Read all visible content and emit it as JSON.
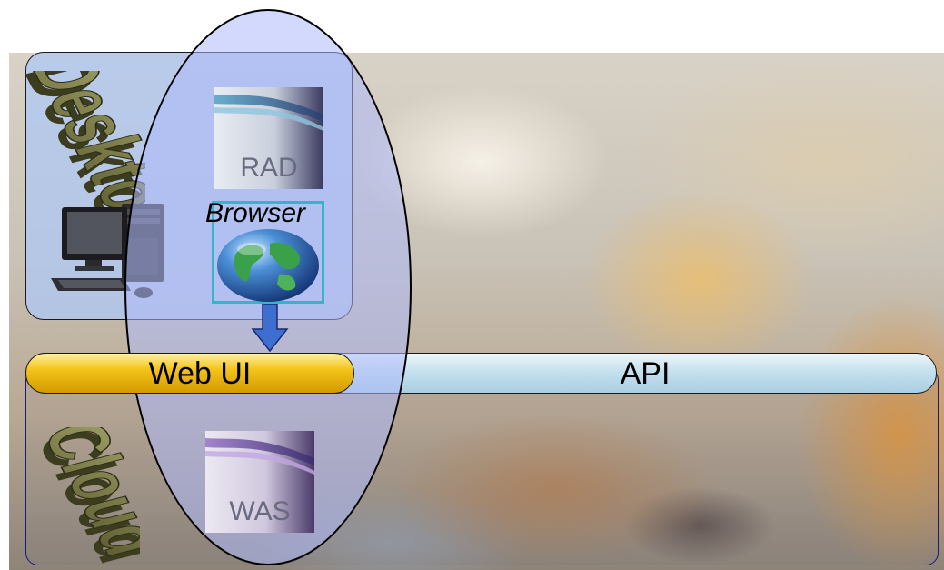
{
  "desktop": {
    "title": "Desktop"
  },
  "cloud": {
    "title": "Cloud"
  },
  "products": {
    "rad_label": "RAD",
    "was_label": "WAS",
    "browser_label": "Browser"
  },
  "bars": {
    "web_ui_label": "Web UI",
    "api_label": "API"
  },
  "icons": {
    "computer": "desktop-computer-icon",
    "globe": "globe-icon",
    "arrow": "down-arrow-icon"
  },
  "colors": {
    "desktop_fill": "#afc8f5",
    "ellipse_fill": "#afb9fa",
    "web_ui_fill": "#f3c41a",
    "api_fill": "#c5e1ee",
    "globe_frame": "#38b4c8",
    "word_art": "#7a7a3a"
  }
}
